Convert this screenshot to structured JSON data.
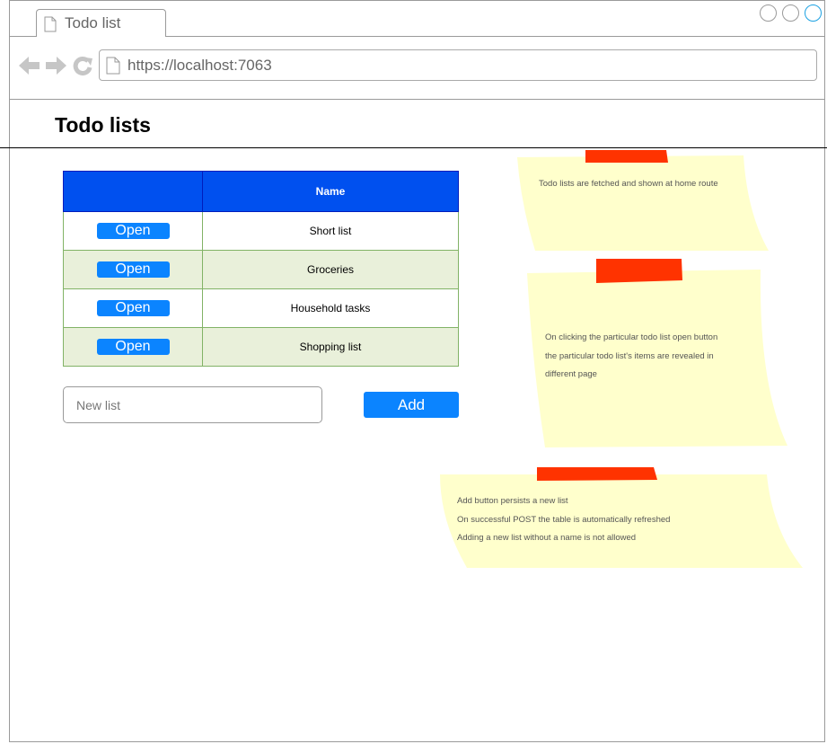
{
  "browser": {
    "tab_title": "Todo list",
    "url": "https://localhost:7063"
  },
  "page": {
    "title": "Todo lists"
  },
  "table": {
    "columns": [
      "",
      "Name"
    ],
    "open_label": "Open",
    "rows": [
      {
        "name": "Short list"
      },
      {
        "name": "Groceries"
      },
      {
        "name": "Household tasks"
      },
      {
        "name": "Shopping list"
      }
    ]
  },
  "form": {
    "placeholder": "New list",
    "add_label": "Add"
  },
  "notes": [
    {
      "lines": [
        "Todo lists are fetched and shown at home route"
      ]
    },
    {
      "lines": [
        "On clicking the particular todo list open button",
        "the particular todo list's items are revealed in",
        "different page"
      ]
    },
    {
      "lines": [
        "Add button persists a new list",
        "On successful POST the table is automatically refreshed",
        "Adding a new list without a name is not allowed"
      ]
    }
  ],
  "colors": {
    "header_bg": "#0050ef",
    "button_bg": "#0b84ff",
    "row_alt_bg": "#e9f0da",
    "note_bg": "#ffffcc",
    "tape": "#ff3300"
  },
  "icons": [
    "doc-icon",
    "back-arrow-icon",
    "forward-arrow-icon",
    "refresh-icon"
  ]
}
